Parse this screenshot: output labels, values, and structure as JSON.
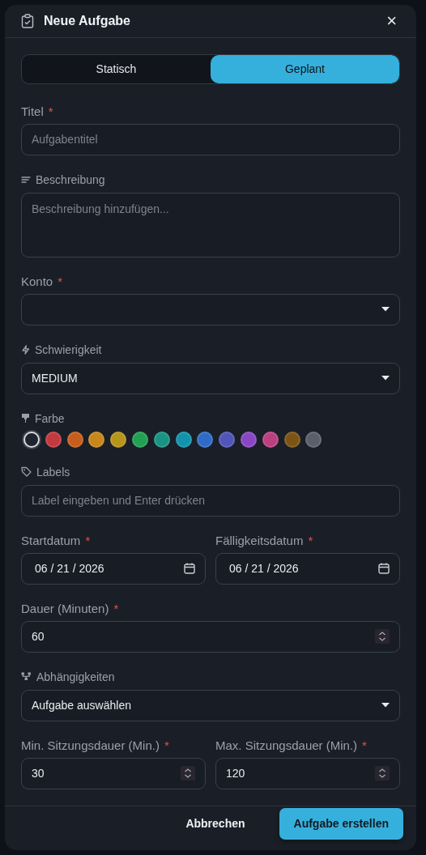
{
  "dialog": {
    "title": "Neue Aufgabe",
    "close": "×"
  },
  "mode_tabs": [
    {
      "label": "Statisch",
      "selected": false
    },
    {
      "label": "Geplant",
      "selected": true
    }
  ],
  "fields": [
    {
      "kind": "title",
      "label": "Titel",
      "required_mark": "*",
      "placeholder": "Aufgabentitel"
    },
    {
      "kind": "description",
      "label": "Beschreibung",
      "placeholder": "Beschreibung hinzufügen..."
    },
    {
      "kind": "account",
      "label": "Konto",
      "required_mark": "*"
    },
    {
      "kind": "difficulty",
      "label": "Schwierigkeit",
      "value": "MEDIUM"
    },
    {
      "kind": "color",
      "label": "Farbe",
      "swatches": [
        {
          "color": "#1f2530",
          "selected": true
        },
        {
          "color": "#c2393e",
          "selected": false
        },
        {
          "color": "#c65e1c",
          "selected": false
        },
        {
          "color": "#c8861b",
          "selected": false
        },
        {
          "color": "#b7941a",
          "selected": false
        },
        {
          "color": "#22a053",
          "selected": false
        },
        {
          "color": "#1a9384",
          "selected": false
        },
        {
          "color": "#1392ad",
          "selected": false
        },
        {
          "color": "#2f6bc6",
          "selected": false
        },
        {
          "color": "#5155b8",
          "selected": false
        },
        {
          "color": "#8947c4",
          "selected": false
        },
        {
          "color": "#bc3f80",
          "selected": false
        },
        {
          "color": "#7d5413",
          "selected": false
        },
        {
          "color": "#5a5f6a",
          "selected": false
        }
      ]
    },
    {
      "kind": "labels",
      "label": "Labels",
      "placeholder": "Label eingeben und Enter drücken"
    },
    {
      "kind": "pair",
      "items": [
        {
          "kind": "date",
          "label": "Startdatum",
          "required_mark": "*",
          "value": "06 / 21 / 2026"
        },
        {
          "kind": "date",
          "label": "Fälligkeitsdatum",
          "required_mark": "*",
          "value": "06 / 21 / 2026"
        }
      ]
    },
    {
      "kind": "number",
      "label": "Dauer (Minuten)",
      "required_mark": "*",
      "value": "60"
    },
    {
      "kind": "dependencies",
      "label": "Abhängigkeiten",
      "value": "Aufgabe auswählen"
    },
    {
      "kind": "pair",
      "items": [
        {
          "kind": "number",
          "label": "Min. Sitzungsdauer (Min.)",
          "required_mark": "*",
          "value": "30"
        },
        {
          "kind": "number",
          "label": "Max. Sitzungsdauer (Min.)",
          "required_mark": "*",
          "value": "120"
        }
      ]
    }
  ],
  "buttons": [
    {
      "label": "Abbrechen",
      "kind": "secondary"
    },
    {
      "label": "Aufgabe erstellen",
      "kind": "primary"
    }
  ]
}
